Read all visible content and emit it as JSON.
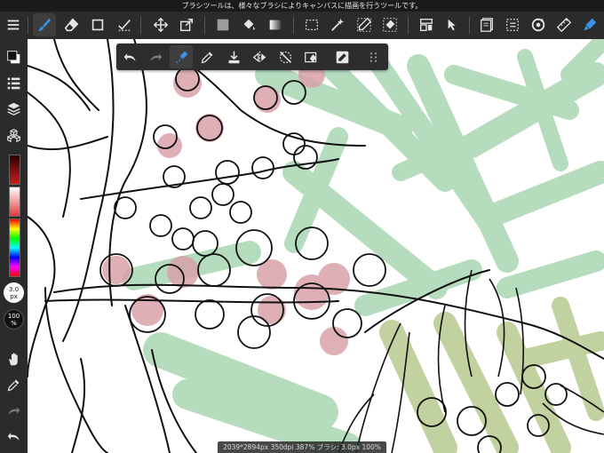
{
  "hint_bar": {
    "text": "ブラシツールは、様々なブラシによりキャンバスに描画を行うツールです。"
  },
  "toolbar": {
    "items": [
      {
        "name": "menu-icon"
      },
      {
        "name": "brush-tool-icon"
      },
      {
        "name": "eraser-tool-icon"
      },
      {
        "name": "rectangle-tool-icon"
      },
      {
        "name": "selection-pen-tool-icon"
      },
      {
        "name": "move-tool-icon"
      },
      {
        "name": "transform-tool-icon"
      },
      {
        "name": "fill-color-icon"
      },
      {
        "name": "bucket-tool-icon"
      },
      {
        "name": "gradient-tool-icon"
      },
      {
        "name": "select-rectangle-icon"
      },
      {
        "name": "magic-wand-icon"
      },
      {
        "name": "select-pen-icon"
      },
      {
        "name": "select-eraser-icon"
      },
      {
        "name": "snap-icon"
      },
      {
        "name": "operate-tool-icon"
      },
      {
        "name": "materials-icon"
      },
      {
        "name": "view-selection-icon"
      },
      {
        "name": "rotate-view-icon"
      },
      {
        "name": "ruler-icon"
      },
      {
        "name": "pen-settings-icon"
      }
    ]
  },
  "sub_toolbar": {
    "items": [
      {
        "name": "undo-icon"
      },
      {
        "name": "redo-icon"
      },
      {
        "name": "stabilizer-icon"
      },
      {
        "name": "eyedropper-icon"
      },
      {
        "name": "download-icon"
      },
      {
        "name": "flip-horizontal-icon"
      },
      {
        "name": "cancel-transform-icon"
      },
      {
        "name": "clear-eraser-icon"
      },
      {
        "name": "edit-icon"
      },
      {
        "name": "more-icon"
      }
    ]
  },
  "sidebar": {
    "brush_size": {
      "value": "3.0",
      "unit": "px"
    },
    "opacity": {
      "value": "100",
      "unit": "%"
    },
    "colors": {
      "primary": "#111111",
      "secondary": "#ffffff",
      "brush": "#2f8be0",
      "accent_red": "#cc1e1e"
    }
  },
  "status_bar": {
    "text": "2039*2894px 350dpi 387% ブラシ: 3.0px 100%"
  }
}
